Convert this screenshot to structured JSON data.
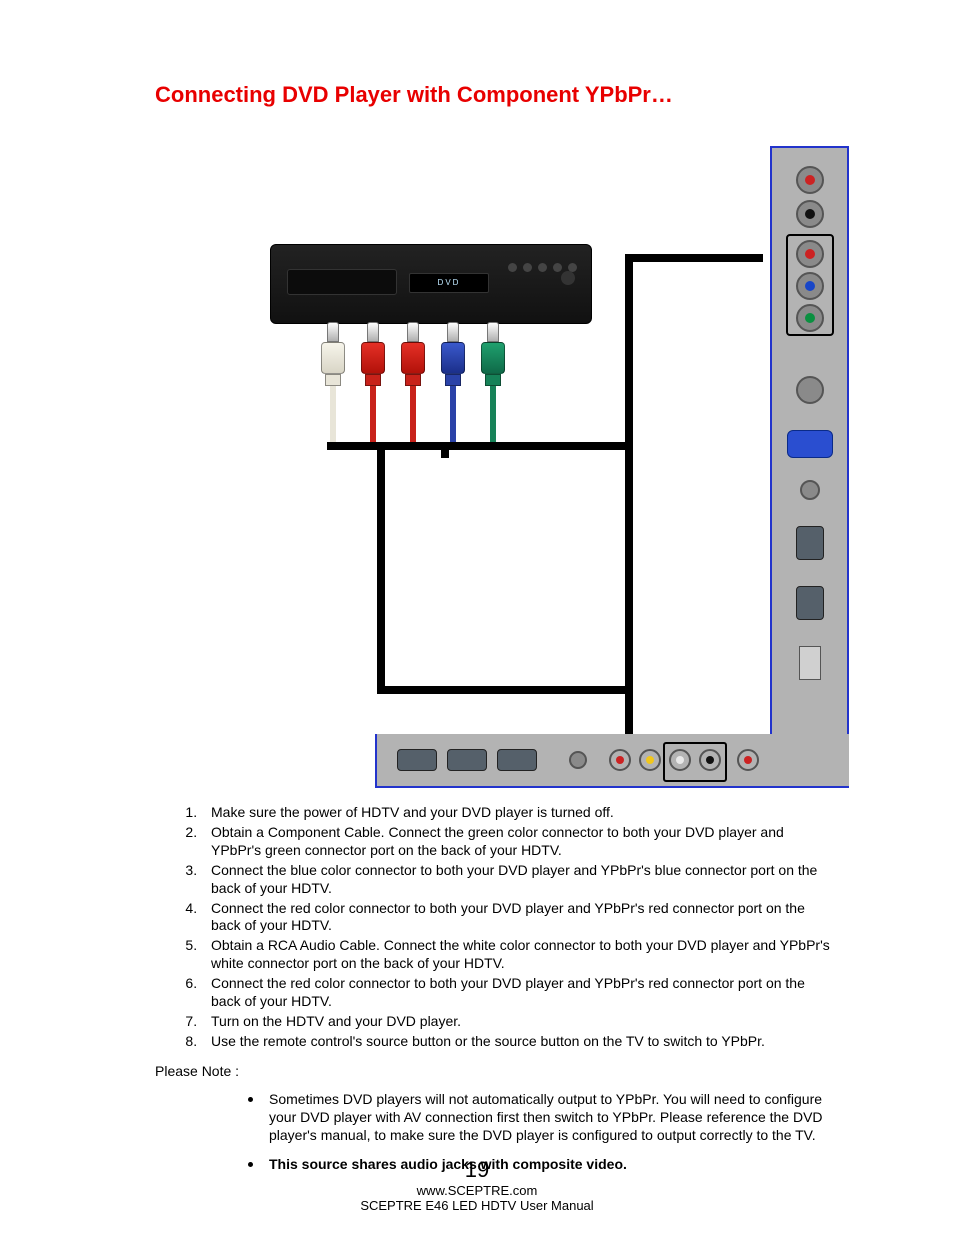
{
  "heading": "Connecting DVD Player with Component YPbPr…",
  "dvd_display": "DVD",
  "cable_plugs": [
    "white",
    "red",
    "red",
    "blue",
    "green"
  ],
  "side_panel": {
    "audio_jacks": [
      "red",
      "white"
    ],
    "ypbpr_jacks": [
      "red",
      "blue",
      "green"
    ],
    "other_ports": [
      "coax",
      "vga",
      "3.5mm",
      "hdmi",
      "hdmi",
      "usb"
    ]
  },
  "bottom_panel": {
    "hdmi_count": 3,
    "ports": [
      "3.5mm",
      "rca-red",
      "rca-yellow",
      "rca-white",
      "rca-black",
      "rca-red"
    ]
  },
  "instructions": [
    "Make sure the power of HDTV and your DVD player is turned off.",
    "Obtain a Component Cable. Connect the green color connector to both your DVD player and YPbPr's green connector port on the back of your HDTV.",
    "Connect the blue color connector to both your DVD player and YPbPr's blue connector port on the back of your HDTV.",
    "Connect the red color connector to both your DVD player and YPbPr's red connector port on the back of your HDTV.",
    "Obtain a RCA Audio Cable.  Connect the white color connector to both your DVD player and YPbPr's white connector port on the back of your HDTV.",
    "Connect the red color connector to both your DVD player and YPbPr's red connector port on the back of your HDTV.",
    "Turn on the HDTV and your DVD player.",
    "Use the remote control's source button or the source button on the TV to switch to YPbPr."
  ],
  "please_note_label": "Please Note :",
  "notes": [
    "Sometimes DVD players will not automatically output to YPbPr.  You will need to configure your DVD player with AV connection first then switch to YPbPr.  Please reference the DVD player's manual, to make sure the DVD player is configured to output correctly to the TV.",
    "This source shares audio jacks with composite video."
  ],
  "footer": {
    "page_number": "19",
    "url": "www.SCEPTRE.com",
    "title": "SCEPTRE E46 LED HDTV User Manual"
  }
}
